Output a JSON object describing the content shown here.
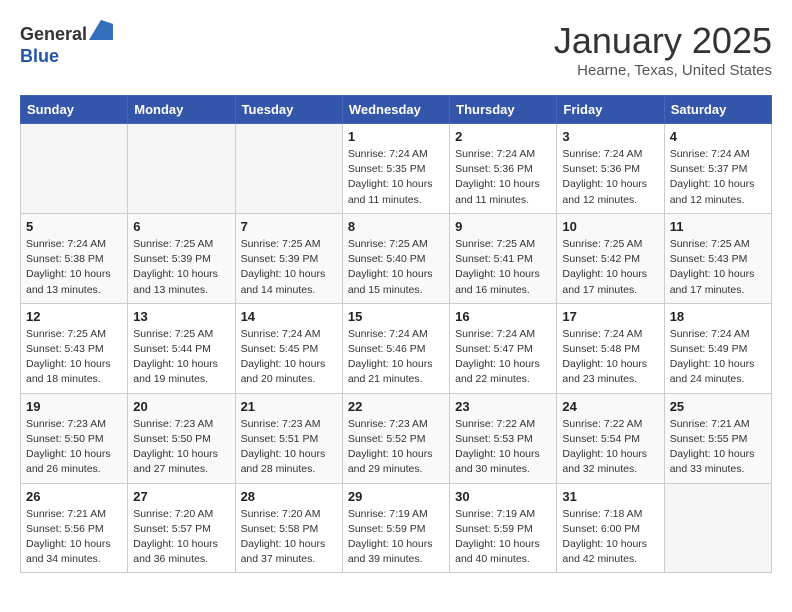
{
  "header": {
    "logo_line1": "General",
    "logo_line2": "Blue",
    "month_title": "January 2025",
    "location": "Hearne, Texas, United States"
  },
  "weekdays": [
    "Sunday",
    "Monday",
    "Tuesday",
    "Wednesday",
    "Thursday",
    "Friday",
    "Saturday"
  ],
  "weeks": [
    [
      {
        "day": "",
        "info": ""
      },
      {
        "day": "",
        "info": ""
      },
      {
        "day": "",
        "info": ""
      },
      {
        "day": "1",
        "info": "Sunrise: 7:24 AM\nSunset: 5:35 PM\nDaylight: 10 hours\nand 11 minutes."
      },
      {
        "day": "2",
        "info": "Sunrise: 7:24 AM\nSunset: 5:36 PM\nDaylight: 10 hours\nand 11 minutes."
      },
      {
        "day": "3",
        "info": "Sunrise: 7:24 AM\nSunset: 5:36 PM\nDaylight: 10 hours\nand 12 minutes."
      },
      {
        "day": "4",
        "info": "Sunrise: 7:24 AM\nSunset: 5:37 PM\nDaylight: 10 hours\nand 12 minutes."
      }
    ],
    [
      {
        "day": "5",
        "info": "Sunrise: 7:24 AM\nSunset: 5:38 PM\nDaylight: 10 hours\nand 13 minutes."
      },
      {
        "day": "6",
        "info": "Sunrise: 7:25 AM\nSunset: 5:39 PM\nDaylight: 10 hours\nand 13 minutes."
      },
      {
        "day": "7",
        "info": "Sunrise: 7:25 AM\nSunset: 5:39 PM\nDaylight: 10 hours\nand 14 minutes."
      },
      {
        "day": "8",
        "info": "Sunrise: 7:25 AM\nSunset: 5:40 PM\nDaylight: 10 hours\nand 15 minutes."
      },
      {
        "day": "9",
        "info": "Sunrise: 7:25 AM\nSunset: 5:41 PM\nDaylight: 10 hours\nand 16 minutes."
      },
      {
        "day": "10",
        "info": "Sunrise: 7:25 AM\nSunset: 5:42 PM\nDaylight: 10 hours\nand 17 minutes."
      },
      {
        "day": "11",
        "info": "Sunrise: 7:25 AM\nSunset: 5:43 PM\nDaylight: 10 hours\nand 17 minutes."
      }
    ],
    [
      {
        "day": "12",
        "info": "Sunrise: 7:25 AM\nSunset: 5:43 PM\nDaylight: 10 hours\nand 18 minutes."
      },
      {
        "day": "13",
        "info": "Sunrise: 7:25 AM\nSunset: 5:44 PM\nDaylight: 10 hours\nand 19 minutes."
      },
      {
        "day": "14",
        "info": "Sunrise: 7:24 AM\nSunset: 5:45 PM\nDaylight: 10 hours\nand 20 minutes."
      },
      {
        "day": "15",
        "info": "Sunrise: 7:24 AM\nSunset: 5:46 PM\nDaylight: 10 hours\nand 21 minutes."
      },
      {
        "day": "16",
        "info": "Sunrise: 7:24 AM\nSunset: 5:47 PM\nDaylight: 10 hours\nand 22 minutes."
      },
      {
        "day": "17",
        "info": "Sunrise: 7:24 AM\nSunset: 5:48 PM\nDaylight: 10 hours\nand 23 minutes."
      },
      {
        "day": "18",
        "info": "Sunrise: 7:24 AM\nSunset: 5:49 PM\nDaylight: 10 hours\nand 24 minutes."
      }
    ],
    [
      {
        "day": "19",
        "info": "Sunrise: 7:23 AM\nSunset: 5:50 PM\nDaylight: 10 hours\nand 26 minutes."
      },
      {
        "day": "20",
        "info": "Sunrise: 7:23 AM\nSunset: 5:50 PM\nDaylight: 10 hours\nand 27 minutes."
      },
      {
        "day": "21",
        "info": "Sunrise: 7:23 AM\nSunset: 5:51 PM\nDaylight: 10 hours\nand 28 minutes."
      },
      {
        "day": "22",
        "info": "Sunrise: 7:23 AM\nSunset: 5:52 PM\nDaylight: 10 hours\nand 29 minutes."
      },
      {
        "day": "23",
        "info": "Sunrise: 7:22 AM\nSunset: 5:53 PM\nDaylight: 10 hours\nand 30 minutes."
      },
      {
        "day": "24",
        "info": "Sunrise: 7:22 AM\nSunset: 5:54 PM\nDaylight: 10 hours\nand 32 minutes."
      },
      {
        "day": "25",
        "info": "Sunrise: 7:21 AM\nSunset: 5:55 PM\nDaylight: 10 hours\nand 33 minutes."
      }
    ],
    [
      {
        "day": "26",
        "info": "Sunrise: 7:21 AM\nSunset: 5:56 PM\nDaylight: 10 hours\nand 34 minutes."
      },
      {
        "day": "27",
        "info": "Sunrise: 7:20 AM\nSunset: 5:57 PM\nDaylight: 10 hours\nand 36 minutes."
      },
      {
        "day": "28",
        "info": "Sunrise: 7:20 AM\nSunset: 5:58 PM\nDaylight: 10 hours\nand 37 minutes."
      },
      {
        "day": "29",
        "info": "Sunrise: 7:19 AM\nSunset: 5:59 PM\nDaylight: 10 hours\nand 39 minutes."
      },
      {
        "day": "30",
        "info": "Sunrise: 7:19 AM\nSunset: 5:59 PM\nDaylight: 10 hours\nand 40 minutes."
      },
      {
        "day": "31",
        "info": "Sunrise: 7:18 AM\nSunset: 6:00 PM\nDaylight: 10 hours\nand 42 minutes."
      },
      {
        "day": "",
        "info": ""
      }
    ]
  ]
}
